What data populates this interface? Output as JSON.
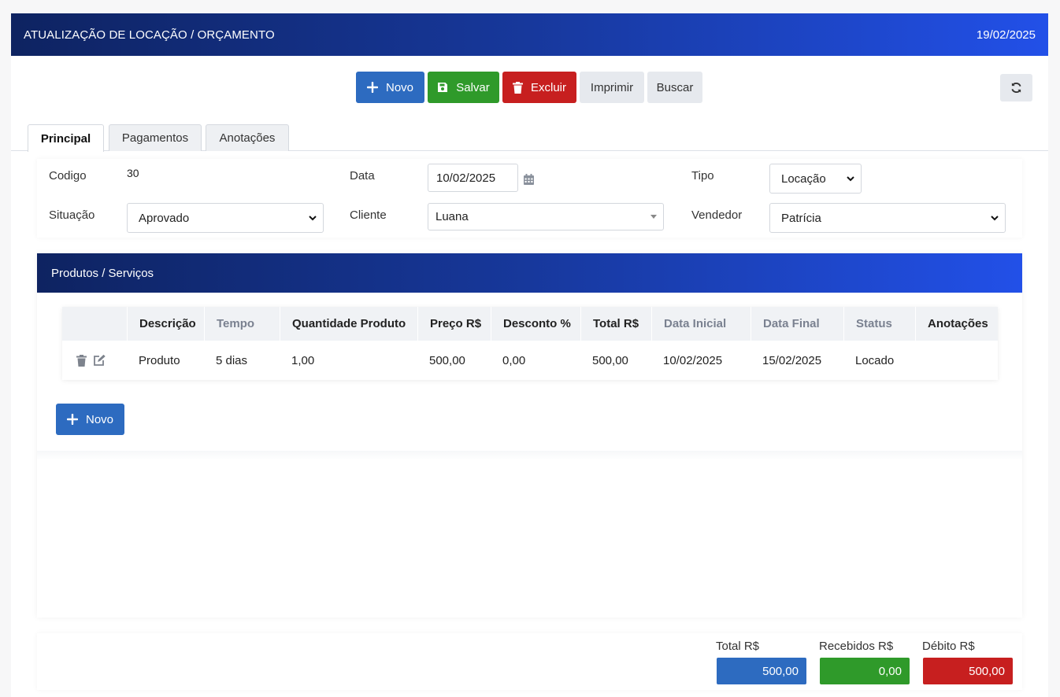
{
  "header": {
    "title": "ATUALIZAÇÃO DE LOCAÇÃO / ORÇAMENTO",
    "date": "19/02/2025"
  },
  "toolbar": {
    "novo_label": "Novo",
    "salvar_label": "Salvar",
    "excluir_label": "Excluir",
    "imprimir_label": "Imprimir",
    "buscar_label": "Buscar",
    "refresh_icon": "refresh-icon"
  },
  "tabs": [
    {
      "label": "Principal",
      "active": true
    },
    {
      "label": "Pagamentos",
      "active": false
    },
    {
      "label": "Anotações",
      "active": false
    }
  ],
  "form": {
    "codigo_label": "Codigo",
    "codigo_value": "30",
    "data_label": "Data",
    "data_value": "10/02/2025",
    "tipo_label": "Tipo",
    "tipo_value": "Locação",
    "situacao_label": "Situação",
    "situacao_value": "Aprovado",
    "cliente_label": "Cliente",
    "cliente_value": "Luana",
    "vendedor_label": "Vendedor",
    "vendedor_value": "Patrícia"
  },
  "produtos": {
    "title": "Produtos / Serviços",
    "columns": [
      "Descrição",
      "Tempo",
      "Quantidade Produto",
      "Preço R$",
      "Desconto %",
      "Total R$",
      "Data Inicial",
      "Data Final",
      "Status",
      "Anotações"
    ],
    "rows": [
      {
        "descricao": "Produto",
        "tempo": "5 dias",
        "quantidade": "1,00",
        "preco": "500,00",
        "desconto": "0,00",
        "total": "500,00",
        "data_inicial": "10/02/2025",
        "data_final": "15/02/2025",
        "status": "Locado",
        "anotacoes": ""
      }
    ],
    "novo_label": "Novo"
  },
  "totais": {
    "total_label": "Total R$",
    "total_value": "500,00",
    "recebidos_label": "Recebidos R$",
    "recebidos_value": "0,00",
    "debito_label": "Débito R$",
    "debito_value": "500,00"
  },
  "colors": {
    "blue": "#2d6bc0",
    "green": "#2f9a2a",
    "red": "#c71f1f",
    "header_start": "#0e2361",
    "header_end": "#2250e8"
  }
}
